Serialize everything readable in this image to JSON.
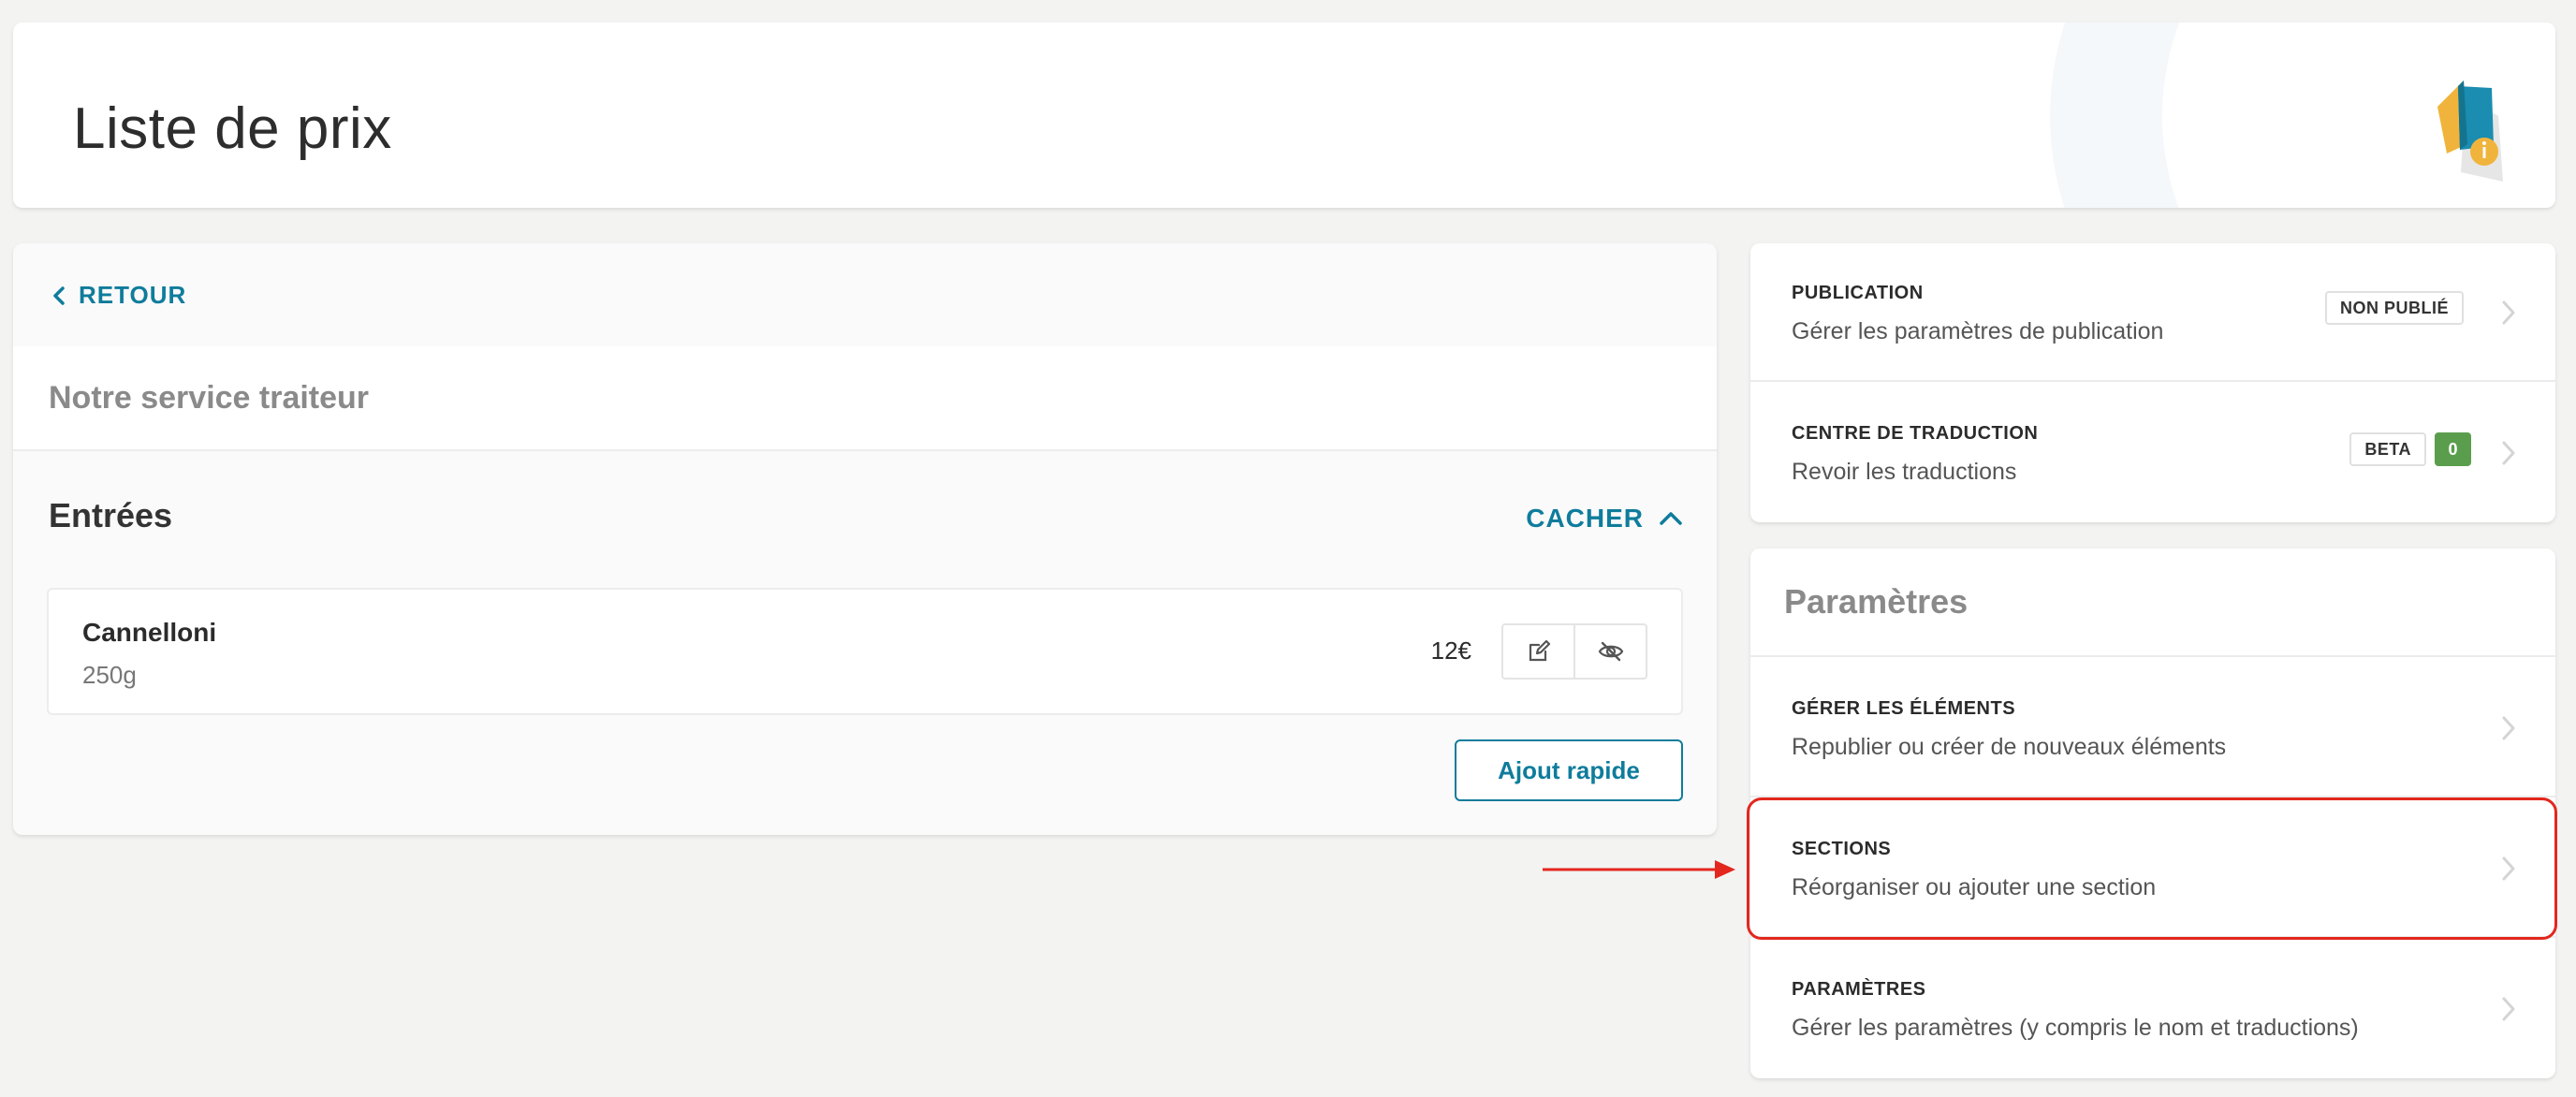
{
  "header": {
    "title": "Liste de prix"
  },
  "main": {
    "back_label": "RETOUR",
    "menu_title": "Notre service traiteur",
    "section": {
      "title": "Entrées",
      "hide_label": "CACHER",
      "items": [
        {
          "name": "Cannelloni",
          "description": "250g",
          "price": "12€"
        }
      ],
      "quick_add_label": "Ajout rapide"
    }
  },
  "publication_card": {
    "rows": [
      {
        "label": "PUBLICATION",
        "description": "Gérer les paramètres de publication",
        "badge": "NON PUBLIÉ"
      },
      {
        "label": "CENTRE DE TRADUCTION",
        "description": "Revoir les traductions",
        "badge": "BETA",
        "count": "0"
      }
    ]
  },
  "settings_card": {
    "title": "Paramètres",
    "rows": [
      {
        "label": "GÉRER LES ÉLÉMENTS",
        "description": "Republier ou créer de nouveaux éléments"
      },
      {
        "label": "SECTIONS",
        "description": "Réorganiser ou ajouter une section"
      },
      {
        "label": "PARAMÈTRES",
        "description": "Gérer les paramètres (y compris le nom et traductions)"
      }
    ]
  },
  "colors": {
    "accent": "#0f7c9c",
    "highlight": "#e3271e",
    "count_badge": "#5a9e4d",
    "background": "#f3f3f2"
  },
  "icons": {
    "back": "chevron-left-icon",
    "hide": "chevron-up-icon",
    "edit": "edit-icon",
    "visibility": "eye-off-icon",
    "row": "chevron-right-icon",
    "header_logo": "price-tag-info-icon"
  }
}
